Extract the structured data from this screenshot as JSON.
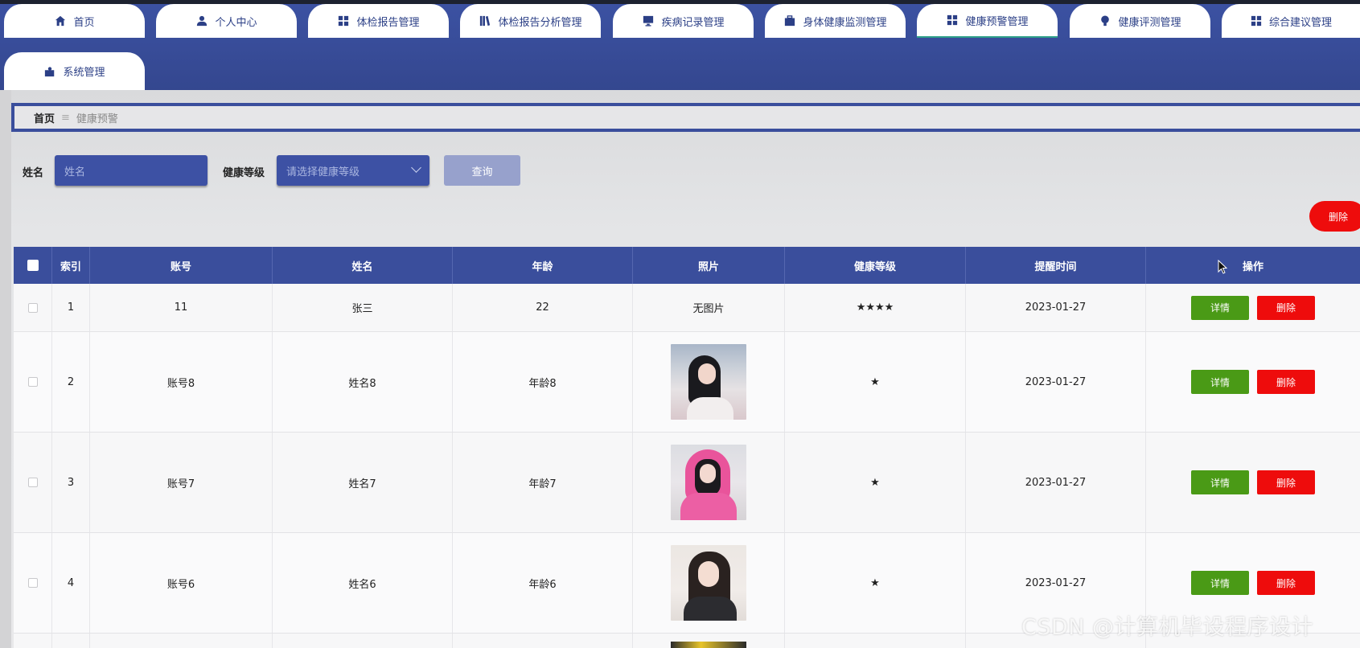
{
  "nav": {
    "row1": [
      {
        "label": "首页",
        "icon": "home-icon"
      },
      {
        "label": "个人中心",
        "icon": "user-icon"
      },
      {
        "label": "体检报告管理",
        "icon": "grid-icon"
      },
      {
        "label": "体检报告分析管理",
        "icon": "book-icon"
      },
      {
        "label": "疾病记录管理",
        "icon": "monitor-icon"
      },
      {
        "label": "身体健康监测管理",
        "icon": "briefcase-icon"
      },
      {
        "label": "健康预警管理",
        "icon": "grid-icon",
        "active": true
      },
      {
        "label": "健康评测管理",
        "icon": "bulb-icon"
      },
      {
        "label": "综合建议管理",
        "icon": "grid-icon"
      }
    ],
    "row2": [
      {
        "label": "系统管理",
        "icon": "puzzle-icon"
      }
    ]
  },
  "breadcrumb": {
    "home": "首页",
    "separator": "≡",
    "current": "健康预警"
  },
  "search": {
    "name_label": "姓名",
    "name_placeholder": "姓名",
    "level_label": "健康等级",
    "level_placeholder": "请选择健康等级",
    "query_button": "查询"
  },
  "toolbar": {
    "delete_label": "删除"
  },
  "table": {
    "columns": [
      "索引",
      "账号",
      "姓名",
      "年龄",
      "照片",
      "健康等级",
      "提醒时间",
      "操作"
    ],
    "rows": [
      {
        "index": "1",
        "account": "11",
        "name": "张三",
        "age": "22",
        "photo": "无图片",
        "level": "★★★★",
        "time": "2023-01-27",
        "detail": "详情",
        "delete": "删除"
      },
      {
        "index": "2",
        "account": "账号8",
        "name": "姓名8",
        "age": "年龄8",
        "photo": "",
        "level": "★",
        "time": "2023-01-27",
        "detail": "详情",
        "delete": "删除"
      },
      {
        "index": "3",
        "account": "账号7",
        "name": "姓名7",
        "age": "年龄7",
        "photo": "",
        "level": "★",
        "time": "2023-01-27",
        "detail": "详情",
        "delete": "删除"
      },
      {
        "index": "4",
        "account": "账号6",
        "name": "姓名6",
        "age": "年龄6",
        "photo": "",
        "level": "★",
        "time": "2023-01-27",
        "detail": "详情",
        "delete": "删除"
      }
    ]
  },
  "watermark": "CSDN @计算机毕设程序设计",
  "colors": {
    "primary": "#3a4e9c",
    "detail": "#4a9a16",
    "danger": "#ee0c0c"
  }
}
